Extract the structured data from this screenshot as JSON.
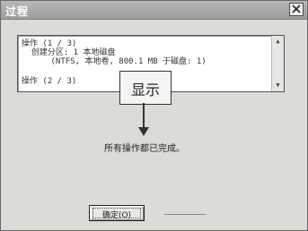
{
  "window": {
    "title": "过程"
  },
  "log": {
    "lines": [
      "操作 (1 / 3)",
      "  创建分区: 1 本地磁盘",
      "      (NTFS, 本地卷, 800.1 MB 于磁盘: 1)",
      "操作 (2 / 3)"
    ]
  },
  "callout": {
    "label": "显示"
  },
  "status": {
    "message": "所有操作都已完成。"
  },
  "buttons": {
    "ok_label": "确定(O)"
  },
  "icons": {
    "close": "close-icon",
    "scroll_up": "scroll-up-icon",
    "scroll_down": "scroll-down-icon",
    "arrow": "down-arrow-icon"
  }
}
